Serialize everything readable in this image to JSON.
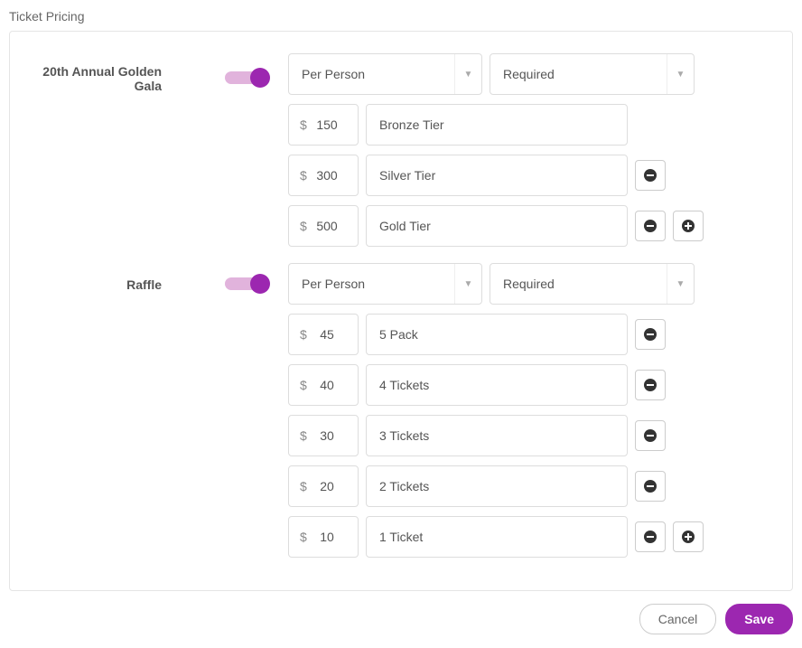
{
  "page_title": "Ticket Pricing",
  "currency_symbol": "$",
  "sections": [
    {
      "label": "20th Annual Golden Gala",
      "enabled": true,
      "basis": "Per Person",
      "requirement": "Required",
      "tiers": [
        {
          "price": "150",
          "name": "Bronze Tier",
          "remove": false,
          "add": false
        },
        {
          "price": "300",
          "name": "Silver Tier",
          "remove": true,
          "add": false
        },
        {
          "price": "500",
          "name": "Gold Tier",
          "remove": true,
          "add": true
        }
      ]
    },
    {
      "label": "Raffle",
      "enabled": true,
      "basis": "Per Person",
      "requirement": "Required",
      "tiers": [
        {
          "price": "45",
          "name": "5 Pack",
          "remove": true,
          "add": false
        },
        {
          "price": "40",
          "name": "4 Tickets",
          "remove": true,
          "add": false
        },
        {
          "price": "30",
          "name": "3 Tickets",
          "remove": true,
          "add": false
        },
        {
          "price": "20",
          "name": "2 Tickets",
          "remove": true,
          "add": false
        },
        {
          "price": "10",
          "name": "1 Ticket",
          "remove": true,
          "add": true
        }
      ]
    }
  ],
  "footer": {
    "cancel": "Cancel",
    "save": "Save"
  }
}
